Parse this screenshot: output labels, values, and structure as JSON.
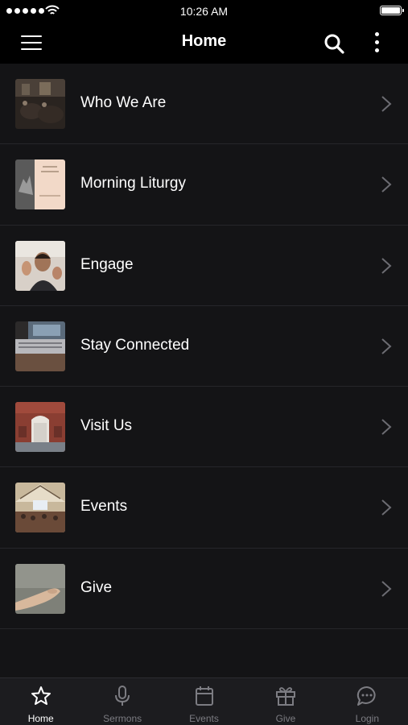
{
  "status_bar": {
    "time": "10:26 AM"
  },
  "header": {
    "title": "Home"
  },
  "menu_items": [
    {
      "label": "Who We Are"
    },
    {
      "label": "Morning Liturgy"
    },
    {
      "label": "Engage"
    },
    {
      "label": "Stay Connected"
    },
    {
      "label": "Visit Us"
    },
    {
      "label": "Events"
    },
    {
      "label": "Give"
    }
  ],
  "tabs": [
    {
      "label": "Home",
      "icon": "star-icon",
      "active": true
    },
    {
      "label": "Sermons",
      "icon": "microphone-icon",
      "active": false
    },
    {
      "label": "Events",
      "icon": "calendar-icon",
      "active": false
    },
    {
      "label": "Give",
      "icon": "gift-icon",
      "active": false
    },
    {
      "label": "Login",
      "icon": "chat-bubble-icon",
      "active": false
    }
  ],
  "colors": {
    "background": "#141416",
    "bar": "#000000",
    "tab_bar": "#1c1c1f",
    "inactive": "#7c7c82",
    "active": "#ffffff"
  }
}
